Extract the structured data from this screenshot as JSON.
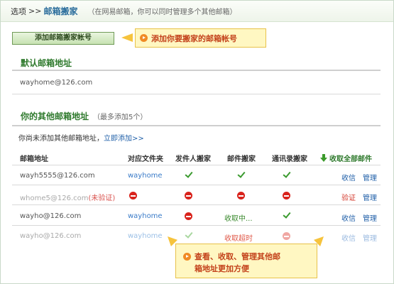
{
  "breadcrumb": {
    "root": "选项",
    "sep": ">>",
    "current": "邮箱搬家",
    "note": "（在网易邮箱，你可以同时管理多个其他邮箱）"
  },
  "add_button": {
    "label": "添加邮箱搬家帐号"
  },
  "callouts": {
    "top": "添加你要搬家的邮箱帐号",
    "bottom_line1": "查看、收取、管理其他邮",
    "bottom_line2": "箱地址更加方便"
  },
  "default_section": {
    "title": "默认邮箱地址",
    "address": "wayhome@126.com"
  },
  "other_section": {
    "title": "你的其他邮箱地址",
    "note": "（最多添加5个）",
    "prompt": "你尚未添加其他邮箱地址，",
    "add_link": "立即添加>>"
  },
  "table": {
    "headers": {
      "address": "邮箱地址",
      "folder": "对应文件夹",
      "sender": "发件人搬家",
      "mail": "邮件搬家",
      "contacts": "通讯录搬家",
      "fetch_all": "收取全部邮件"
    },
    "rows": [
      {
        "address": "wayh5555@126.com",
        "folder": "wayhome",
        "action1": "收信",
        "action2": "管理"
      },
      {
        "address": "whome5@126.com",
        "badge": "(未验证)",
        "action1": "验证",
        "action2": "管理"
      },
      {
        "address": "wayho@126.com",
        "folder": "wayhome",
        "mail_status": "收取中...",
        "action1": "收信",
        "action2": "管理"
      },
      {
        "address": "wayho@126.com",
        "folder": "wayhome",
        "mail_status": "收取超时",
        "action1": "收信",
        "action2": "管理"
      }
    ]
  },
  "colors": {
    "accent_green": "#2f7a2d",
    "link_blue": "#1f5fa8",
    "callout_bg": "#fff7c2",
    "callout_text": "#c3421b",
    "error_red": "#d9231c"
  }
}
